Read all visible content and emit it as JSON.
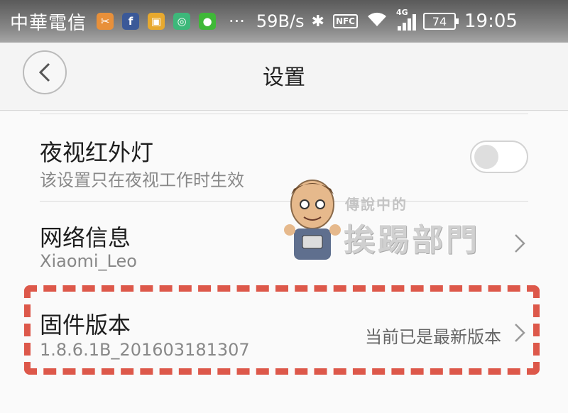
{
  "status_bar": {
    "carrier": "中華電信",
    "app_icons": [
      {
        "name": "tools-app-icon",
        "glyph": "✂",
        "color": "#e8903a"
      },
      {
        "name": "facebook-icon",
        "glyph": "f",
        "color": "#3b5998"
      },
      {
        "name": "lock-app-icon",
        "glyph": "▣",
        "color": "#e8a92e"
      },
      {
        "name": "mi-home-icon",
        "glyph": "◎",
        "color": "#3db87a"
      },
      {
        "name": "wechat-icon",
        "glyph": "●",
        "color": "#3fb838"
      }
    ],
    "overflow": "···",
    "net_speed": "59B/s",
    "nfc": "NFC",
    "network_type": "4G",
    "battery": "74",
    "time": "19:05"
  },
  "header": {
    "title": "设置"
  },
  "settings": {
    "night_ir": {
      "title": "夜视红外灯",
      "subtitle": "该设置只在夜视工作时生效",
      "toggle_on": false
    },
    "network": {
      "title": "网络信息",
      "subtitle": "Xiaomi_Leo"
    },
    "firmware": {
      "title": "固件版本",
      "subtitle": "1.8.6.1B_201603181307",
      "value": "当前已是最新版本"
    }
  },
  "watermark": {
    "line1": "傳說中的",
    "line2": "挨踢部門"
  },
  "colors": {
    "highlight": "#dd584a",
    "background": "#fafafa"
  }
}
